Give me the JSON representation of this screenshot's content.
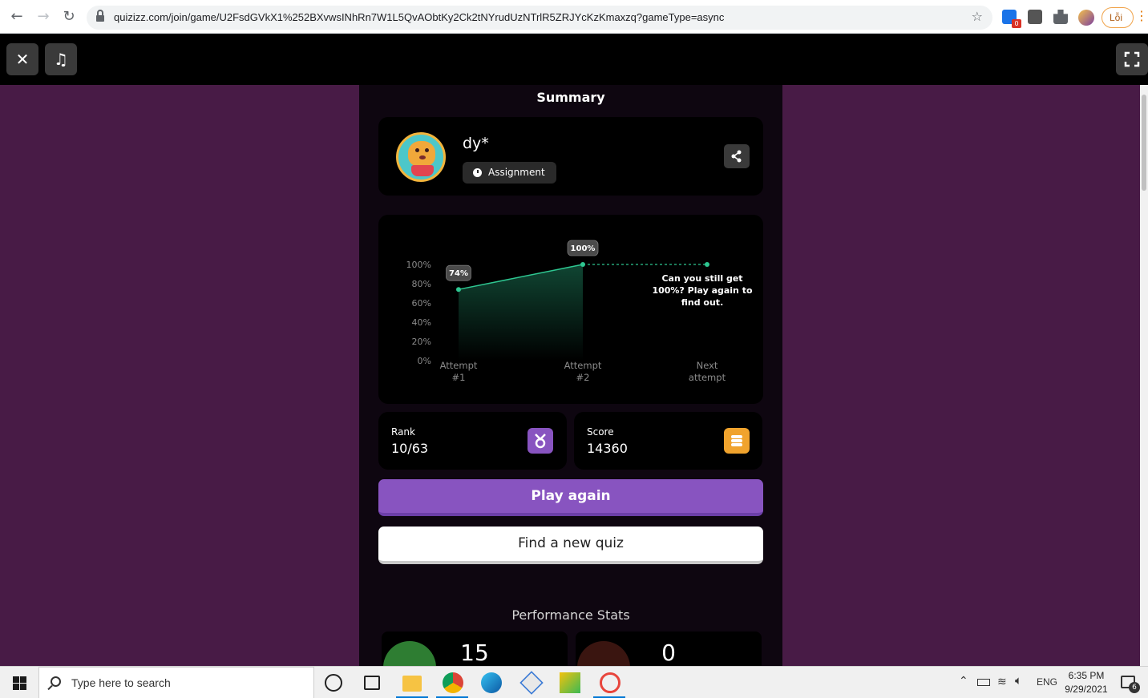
{
  "browser": {
    "url": "quizizz.com/join/game/U2FsdGVkX1%252BXvwsINhRn7W1L5QvAObtKy2Ck2tNYrudUzNTrlR5ZRJYcKzKmaxzq?gameType=async",
    "error_label": "Lỗi",
    "extension_badge": "0"
  },
  "summary": {
    "title": "Summary",
    "player_name": "dy*",
    "mode_label": "Assignment"
  },
  "chart_data": {
    "type": "line",
    "categories": [
      "Attempt #1",
      "Attempt #2",
      "Next attempt"
    ],
    "category_lines": [
      [
        "Attempt",
        "#1"
      ],
      [
        "Attempt",
        "#2"
      ],
      [
        "Next",
        "attempt"
      ]
    ],
    "series": [
      {
        "values": [
          74,
          100,
          null
        ]
      }
    ],
    "projection": {
      "from": "Attempt #2",
      "to": "Next attempt",
      "value": 100
    },
    "data_labels": [
      "74%",
      "100%"
    ],
    "y_ticks": [
      "100%",
      "80%",
      "60%",
      "40%",
      "20%",
      "0%"
    ],
    "ylim": [
      0,
      100
    ],
    "annotation": [
      "Can you still get",
      "100%? Play again to",
      "find out."
    ],
    "line_color": "#2ec791",
    "grid": false
  },
  "stats": {
    "rank_label": "Rank",
    "rank_value": "10/63",
    "score_label": "Score",
    "score_value": "14360",
    "rank_icon_color": "#8854c0",
    "score_icon_color": "#f0a32d"
  },
  "actions": {
    "play_again": "Play again",
    "find_new_quiz": "Find a new quiz"
  },
  "performance": {
    "title": "Performance Stats",
    "correct_count": "15",
    "incorrect_count": "0"
  },
  "taskbar": {
    "search_placeholder": "Type here to search",
    "language": "ENG",
    "time": "6:35 PM",
    "date": "9/29/2021",
    "notification_count": "6"
  },
  "colors": {
    "page_bg": "#481b46",
    "accent": "#8854c0",
    "correct": "#2e7d32",
    "incorrect": "#5a1d12"
  }
}
